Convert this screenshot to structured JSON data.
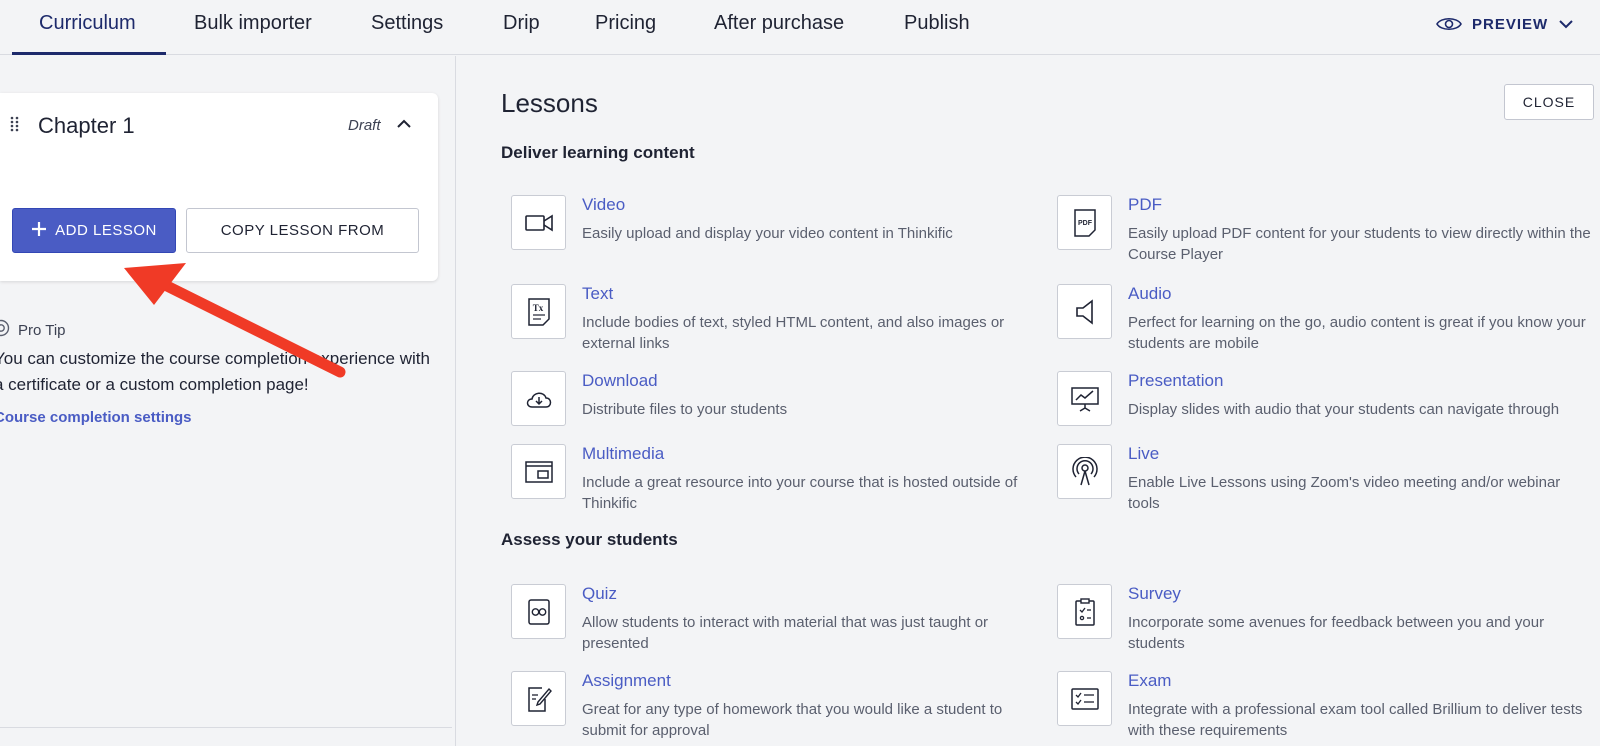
{
  "nav": {
    "tabs": [
      {
        "label": "Curriculum",
        "active": true
      },
      {
        "label": "Bulk importer"
      },
      {
        "label": "Settings"
      },
      {
        "label": "Drip"
      },
      {
        "label": "Pricing"
      },
      {
        "label": "After purchase"
      },
      {
        "label": "Publish"
      }
    ],
    "preview_label": "PREVIEW"
  },
  "chapter": {
    "title": "Chapter 1",
    "status": "Draft",
    "add_lesson_label": "ADD LESSON",
    "copy_lesson_label": "COPY LESSON FROM"
  },
  "protip": {
    "heading": "Pro Tip",
    "text": "You can customize the course completion experience with a certificate or a custom completion page!",
    "link": "Course completion settings"
  },
  "lessons": {
    "title": "Lessons",
    "close_label": "CLOSE",
    "sections": [
      {
        "heading": "Deliver learning content",
        "items": [
          {
            "title": "Video",
            "desc": "Easily upload and display your video content in Thinkific",
            "icon": "video-icon"
          },
          {
            "title": "PDF",
            "desc": "Easily upload PDF content for your students to view directly within the Course Player",
            "icon": "pdf-icon"
          },
          {
            "title": "Text",
            "desc": "Include bodies of text, styled HTML content, and also images or external links",
            "icon": "text-icon"
          },
          {
            "title": "Audio",
            "desc": "Perfect for learning on the go, audio content is great if you know your students are mobile",
            "icon": "audio-icon"
          },
          {
            "title": "Download",
            "desc": "Distribute files to your students",
            "icon": "download-icon"
          },
          {
            "title": "Presentation",
            "desc": "Display slides with audio that your students can navigate through",
            "icon": "presentation-icon"
          },
          {
            "title": "Multimedia",
            "desc": "Include a great resource into your course that is hosted outside of Thinkific",
            "icon": "multimedia-icon"
          },
          {
            "title": "Live",
            "desc": "Enable Live Lessons using Zoom's video meeting and/or webinar tools",
            "icon": "live-icon"
          }
        ]
      },
      {
        "heading": "Assess your students",
        "items": [
          {
            "title": "Quiz",
            "desc": "Allow students to interact with material that was just taught or presented",
            "icon": "quiz-icon"
          },
          {
            "title": "Survey",
            "desc": "Incorporate some avenues for feedback between you and your students",
            "icon": "survey-icon"
          },
          {
            "title": "Assignment",
            "desc": "Great for any type of homework that you would like a student to submit for approval",
            "icon": "assignment-icon"
          },
          {
            "title": "Exam",
            "desc": "Integrate with a professional exam tool called Brillium to deliver tests with these requirements",
            "icon": "exam-icon"
          }
        ]
      }
    ]
  },
  "colors": {
    "accent": "#4a5cc4",
    "nav_active": "#1d2a6b",
    "annotation_arrow": "#f03a26"
  }
}
